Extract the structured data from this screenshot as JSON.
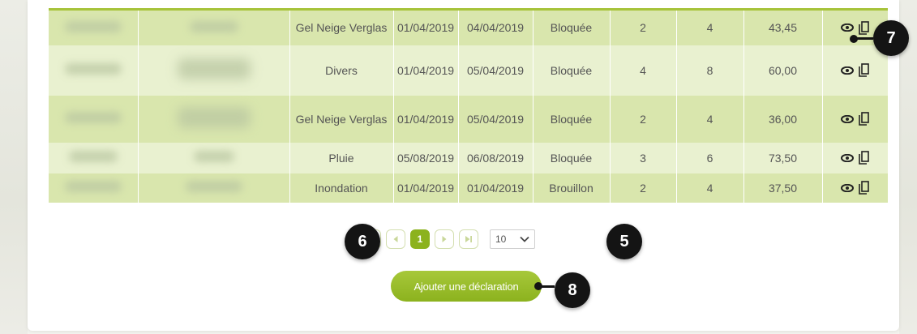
{
  "table": {
    "rows": [
      {
        "type": "Gel Neige Verglas",
        "start": "01/04/2019",
        "end": "04/04/2019",
        "status": "Bloquée",
        "n1": "2",
        "n2": "4",
        "amount": "43,45"
      },
      {
        "type": "Divers",
        "start": "01/04/2019",
        "end": "05/04/2019",
        "status": "Bloquée",
        "n1": "4",
        "n2": "8",
        "amount": "60,00"
      },
      {
        "type": "Gel Neige Verglas",
        "start": "01/04/2019",
        "end": "05/04/2019",
        "status": "Bloquée",
        "n1": "2",
        "n2": "4",
        "amount": "36,00"
      },
      {
        "type": "Pluie",
        "start": "05/08/2019",
        "end": "06/08/2019",
        "status": "Bloquée",
        "n1": "3",
        "n2": "6",
        "amount": "73,50"
      },
      {
        "type": "Inondation",
        "start": "01/04/2019",
        "end": "01/04/2019",
        "status": "Brouillon",
        "n1": "2",
        "n2": "4",
        "amount": "37,50"
      }
    ]
  },
  "pagination": {
    "current_page": "1",
    "page_size": "10"
  },
  "add_button": {
    "label": "Ajouter une déclaration"
  },
  "callouts": {
    "five": "5",
    "six": "6",
    "seven": "7",
    "eight": "8"
  },
  "colors": {
    "accent": "#8cb21e",
    "row_dark": "#d9e6ad",
    "row_light": "#e9f1d0",
    "callout": "#141414"
  },
  "icons": [
    "eye-icon",
    "copy-icon",
    "first-page-icon",
    "prev-page-icon",
    "next-page-icon",
    "last-page-icon",
    "chevron-down-icon"
  ]
}
